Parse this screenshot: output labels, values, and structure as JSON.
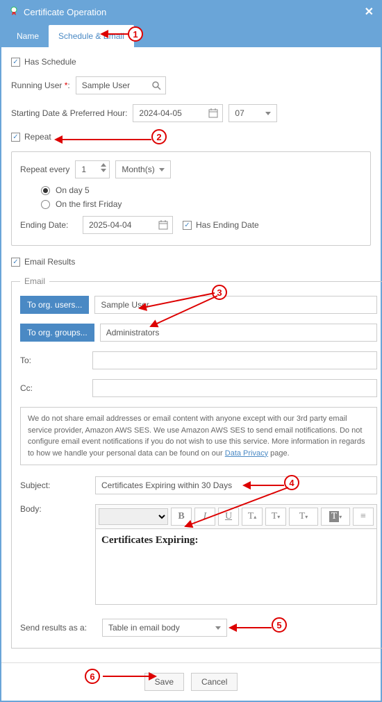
{
  "titlebar": {
    "title": "Certificate Operation"
  },
  "tabs": {
    "name_label": "Name",
    "schedule_label": "Schedule & Email"
  },
  "schedule": {
    "has_schedule_label": "Has Schedule",
    "running_user_label": "Running User",
    "running_user_value": "Sample  User",
    "starting_date_label": "Starting Date & Preferred Hour:",
    "starting_date_value": "2024-04-05",
    "starting_hour_value": "07",
    "repeat_label": "Repeat",
    "repeat_every_label": "Repeat every",
    "repeat_every_value": "1",
    "repeat_unit_value": "Month(s)",
    "on_day_label": "On day 5",
    "on_first_friday_label": "On the first Friday",
    "ending_date_label": "Ending Date:",
    "ending_date_value": "2025-04-04",
    "has_ending_date_label": "Has Ending Date"
  },
  "email": {
    "email_results_label": "Email Results",
    "legend": "Email",
    "to_org_users_btn": "To org. users...",
    "org_users_value": "Sample  User",
    "to_org_groups_btn": "To org. groups...",
    "org_groups_value": "Administrators",
    "to_label": "To:",
    "to_value": "",
    "cc_label": "Cc:",
    "cc_value": "",
    "notice_pre": "We do not share email addresses or email content with anyone except with our 3rd party email service provider, Amazon AWS SES. We use Amazon AWS SES to send email notifications. Do not configure email event notifications if you do not wish to use this service. More information in regards to how we handle your personal data can be found on our ",
    "notice_link": "Data Privacy",
    "notice_post": " page.",
    "subject_label": "Subject:",
    "subject_value": "Certificates Expiring within 30 Days",
    "body_label": "Body:",
    "body_content": "Certificates Expiring:",
    "send_results_label": "Send results as a:",
    "send_results_value": "Table in email body"
  },
  "footer": {
    "save": "Save",
    "cancel": "Cancel"
  },
  "annotations": {
    "a1": "1",
    "a2": "2",
    "a3": "3",
    "a4": "4",
    "a5": "5",
    "a6": "6"
  }
}
